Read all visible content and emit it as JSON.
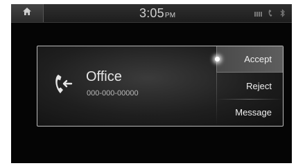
{
  "status_bar": {
    "time": "3:05",
    "ampm": "PM",
    "icons": [
      "home-icon",
      "signal-battery-icon",
      "phone-handset-icon",
      "bluetooth-icon"
    ]
  },
  "call": {
    "caller_name": "Office",
    "caller_number": "000-000-00000",
    "icon": "incoming-call-icon"
  },
  "actions": {
    "accept": "Accept",
    "reject": "Reject",
    "message": "Message",
    "selected": "accept"
  },
  "colors": {
    "background": "#050505",
    "panel_border": "#bcbcbc",
    "text": "#e6e6e6"
  }
}
